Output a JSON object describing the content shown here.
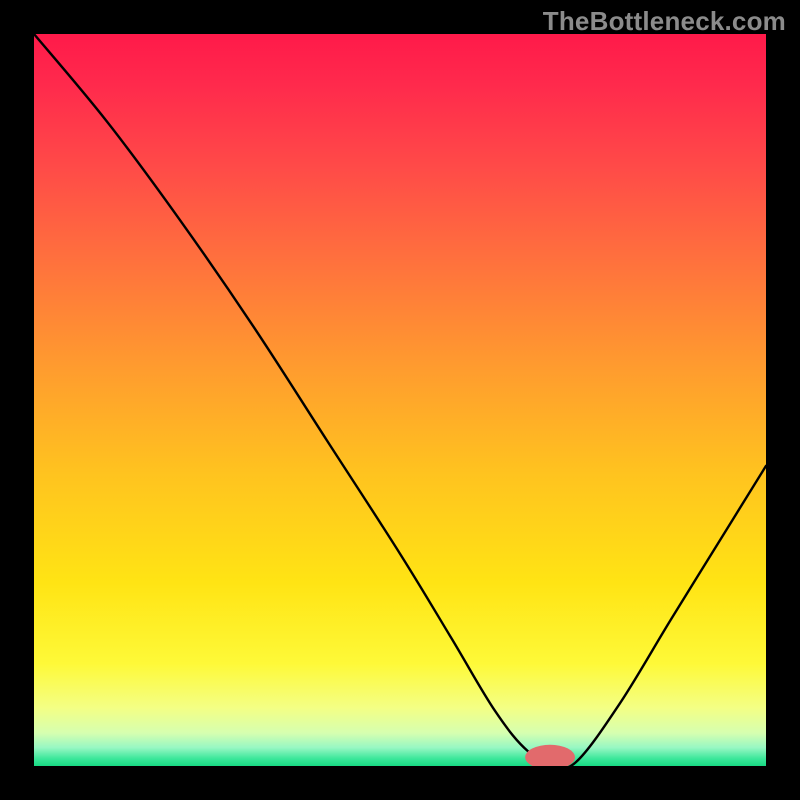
{
  "watermark": "TheBottleneck.com",
  "chart_data": {
    "type": "line",
    "title": "",
    "xlabel": "",
    "ylabel": "",
    "xlim": [
      0,
      100
    ],
    "ylim": [
      0,
      100
    ],
    "background_gradient": {
      "stops": [
        {
          "offset": 0.0,
          "color": "#ff1a4a"
        },
        {
          "offset": 0.07,
          "color": "#ff2a4c"
        },
        {
          "offset": 0.18,
          "color": "#ff4a48"
        },
        {
          "offset": 0.3,
          "color": "#ff6e3e"
        },
        {
          "offset": 0.45,
          "color": "#ff9a2f"
        },
        {
          "offset": 0.6,
          "color": "#ffc31f"
        },
        {
          "offset": 0.75,
          "color": "#ffe414"
        },
        {
          "offset": 0.86,
          "color": "#fef938"
        },
        {
          "offset": 0.92,
          "color": "#f4ff84"
        },
        {
          "offset": 0.955,
          "color": "#d6ffb0"
        },
        {
          "offset": 0.975,
          "color": "#97f7c3"
        },
        {
          "offset": 0.99,
          "color": "#3be79a"
        },
        {
          "offset": 1.0,
          "color": "#18d983"
        }
      ]
    },
    "curve": {
      "x": [
        0.0,
        10.0,
        20.0,
        30.0,
        40.0,
        50.0,
        57.0,
        63.0,
        67.5,
        71.0,
        74.0,
        80.0,
        87.0,
        93.5,
        100.0
      ],
      "y": [
        100.0,
        88.0,
        74.5,
        60.0,
        44.5,
        29.0,
        17.5,
        7.5,
        2.0,
        0.5,
        0.5,
        8.5,
        20.0,
        30.5,
        41.0
      ]
    },
    "marker": {
      "x": 70.5,
      "y": 1.2,
      "rx": 3.4,
      "ry": 1.7,
      "color": "#e26a6c"
    }
  }
}
